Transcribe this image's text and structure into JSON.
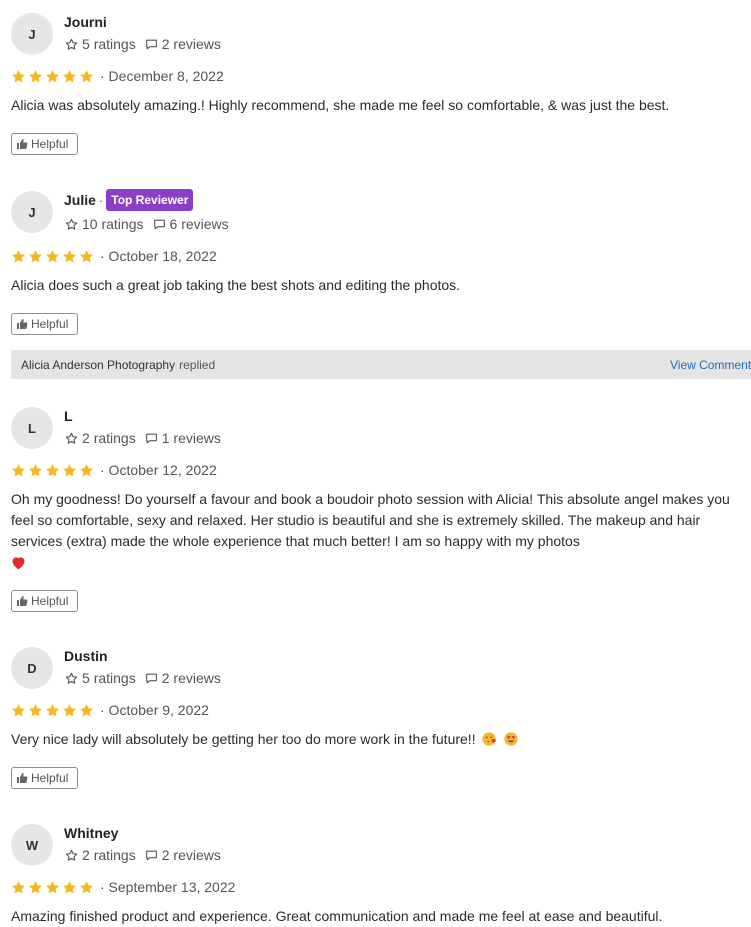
{
  "colors": {
    "star": "#f5b81e",
    "badge": "#8a3fc6",
    "link": "#1a6fc4",
    "reply_bar": "#e4e4e4"
  },
  "helpful_label": "Helpful",
  "ratings_suffix": "ratings",
  "reviews_suffix": "reviews",
  "reviews": [
    {
      "initial": "J",
      "name": "Journi",
      "ratings_count": "5",
      "reviews_count": "2",
      "stars": 5,
      "date": "· December 8, 2022",
      "text": "Alicia was absolutely amazing.! Highly recommend, she made me feel so comfortable, & was just the best."
    },
    {
      "initial": "J",
      "name": "Julie",
      "badge": "Top Reviewer",
      "ratings_count": "10",
      "reviews_count": "6",
      "stars": 5,
      "date": "· October 18, 2022",
      "text": "Alicia does such a great job taking the best shots and editing the photos."
    },
    {
      "initial": "L",
      "name": "L",
      "ratings_count": "2",
      "reviews_count": "1",
      "stars": 5,
      "date": "· October 12, 2022",
      "text": "Oh my goodness! Do yourself a favour and book a boudoir photo session with Alicia! This absolute angel makes you feel so comfortable, sexy and relaxed. Her studio is beautiful and she is extremely skilled. The makeup and hair services (extra) made the whole experience that much better! I am so happy with my photos",
      "emoji": "red-heart-icon"
    },
    {
      "initial": "D",
      "name": "Dustin",
      "ratings_count": "5",
      "reviews_count": "2",
      "stars": 5,
      "date": "· October 9, 2022",
      "text": "Very nice lady will absolutely be getting her too do more work in the future!!",
      "emoji": [
        "face-blowing-kiss-icon",
        "heart-eyes-icon"
      ]
    },
    {
      "initial": "W",
      "name": "Whitney",
      "ratings_count": "2",
      "reviews_count": "2",
      "stars": 5,
      "date": "· September 13, 2022",
      "text": "Amazing finished product and experience. Great communication and made me feel at ease and beautiful."
    }
  ],
  "reply": {
    "business": "Alicia Anderson Photography",
    "replied_label": "replied",
    "view_label": "View Comment"
  }
}
